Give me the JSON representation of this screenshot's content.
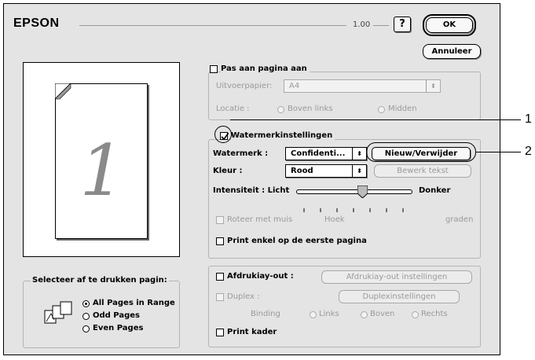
{
  "header": {
    "brand": "EPSON",
    "version": "1.00",
    "help_glyph": "?",
    "ok_label": "OK",
    "cancel_label": "Annuleer"
  },
  "preview": {
    "page_number": "1"
  },
  "pages_select": {
    "title": "Selecteer af te drukken pagin:",
    "options": [
      "All Pages in Range",
      "Odd Pages",
      "Even Pages"
    ]
  },
  "fit_page": {
    "checkbox_label": "Pas aan pagina aan",
    "output_label": "Uitvoerpapier:",
    "output_value": "A4",
    "location_label": "Locatie :",
    "location_options": [
      "Boven links",
      "Midden"
    ]
  },
  "watermark": {
    "checkbox_label": "Watermerkinstellingen",
    "watermark_label": "Watermerk :",
    "watermark_value": "Confidenti...",
    "new_delete_button": "Nieuw/Verwijder",
    "color_label": "Kleur :",
    "color_value": "Rood",
    "edit_text_button": "Bewerk tekst",
    "intensity_label": "Intensiteit : Licht",
    "intensity_dark": "Donker",
    "intensity_level": 0.43,
    "rotate_label": "Roteer met muis",
    "angle_label": "Hoek",
    "degrees_label": "graden",
    "first_page_label": "Print enkel op de eerste pagina"
  },
  "layout": {
    "print_layout_label": "Afdrukiay-out :",
    "layout_settings_button": "Afdrukiay-out instellingen",
    "duplex_label": "Duplex :",
    "duplex_settings_button": "Duplexinstellingen",
    "binding_label": "Binding",
    "binding_options": [
      "Links",
      "Boven",
      "Rechts"
    ],
    "print_frame_label": "Print kader"
  },
  "callouts": [
    "1",
    "2"
  ]
}
